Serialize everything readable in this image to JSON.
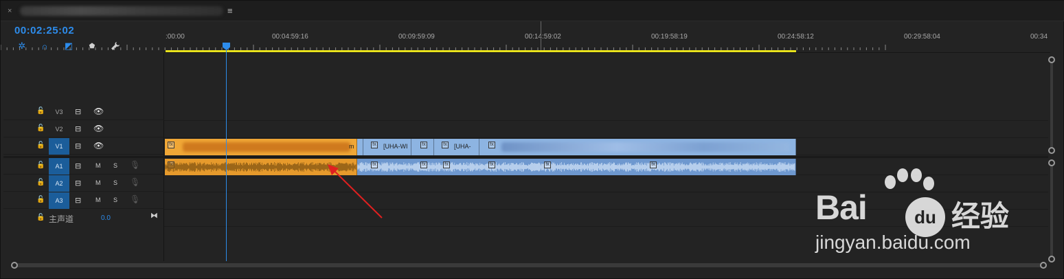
{
  "tab": {
    "close_glyph": "×",
    "title": "",
    "menu_glyph": "≡"
  },
  "timecode": "00:02:25:02",
  "toolbar": [
    {
      "name": "snap-insert-icon",
      "glyph": "✲"
    },
    {
      "name": "snap-magnet-icon",
      "glyph": "∩"
    },
    {
      "name": "linked-selection-icon",
      "glyph": "◩"
    },
    {
      "name": "add-marker-icon",
      "glyph": "⬟"
    },
    {
      "name": "wrench-icon",
      "glyph": "🔧"
    }
  ],
  "ruler": {
    "labels": [
      ":00:00",
      "00:04:59:16",
      "00:09:59:09",
      "00:14:59:02",
      "00:19:58:19",
      "00:24:58:12",
      "00:29:58:04",
      "00:34"
    ],
    "work_area_color": "#e8e21c"
  },
  "tracks": {
    "video": [
      {
        "name": "V3",
        "target": false
      },
      {
        "name": "V2",
        "target": false
      },
      {
        "name": "V1",
        "target": true
      }
    ],
    "audio": [
      {
        "name": "A1",
        "target": true
      },
      {
        "name": "A2",
        "target": true
      },
      {
        "name": "A3",
        "target": true
      }
    ],
    "mute_label": "M",
    "solo_label": "S",
    "master_label": "主声道",
    "master_value": "0.0"
  },
  "clips": {
    "video": [
      {
        "title": "m",
        "color": "orange"
      },
      {
        "title": "[UHA-WI",
        "color": "blue"
      },
      {
        "title": "",
        "color": "blue"
      },
      {
        "title": "[UHA-",
        "color": "blue"
      },
      {
        "title": "",
        "color": "blue"
      }
    ],
    "audio_colors": {
      "orange": "#e69a2c",
      "blue": "#6e98cf"
    }
  },
  "colors": {
    "accent": "#2d8ceb",
    "orange_clip": "#f0a736",
    "blue_clip": "#8db4e2",
    "annotation_arrow": "#e02020"
  },
  "watermark": {
    "word": "Bai",
    "circle": "du",
    "cn": "经验",
    "url": "jingyan.baidu.com"
  }
}
